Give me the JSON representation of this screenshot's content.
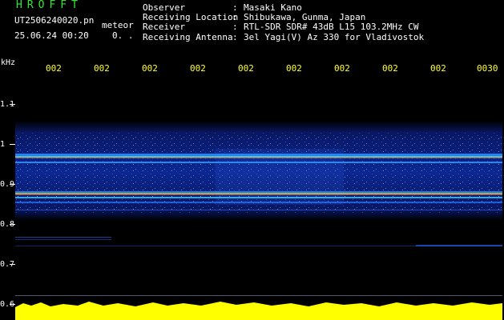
{
  "header": {
    "brand": "HROFFT",
    "filename": "UT2506240020.pn",
    "tag": "meteor",
    "datetime": "25.06.24 00:20",
    "count": "0. ."
  },
  "meta": [
    {
      "label": "Observer",
      "value": "Masaki Kano"
    },
    {
      "label": "Receiving Location",
      "value": "Shibukawa, Gunma, Japan"
    },
    {
      "label": "Receiver",
      "value": "RTL-SDR SDR# 43dB L15 103.2MHz CW"
    },
    {
      "label": "Receiving Antenna",
      "value": "3el Yagi(V) Az 330 for Vladivostok"
    }
  ],
  "axis": {
    "unit": "kHz",
    "y_labels": [
      "1.1",
      "1",
      "0.9",
      "0.8",
      "0.7",
      "0.6"
    ],
    "x_ticks": [
      "002",
      "002",
      "002",
      "002",
      "002",
      "002",
      "002",
      "002",
      "002",
      "0030"
    ]
  },
  "colors": {
    "background": "#000000",
    "text": "#ffffff",
    "brand": "#33e633",
    "tick": "#ffff33",
    "noise": "#ffff00"
  }
}
